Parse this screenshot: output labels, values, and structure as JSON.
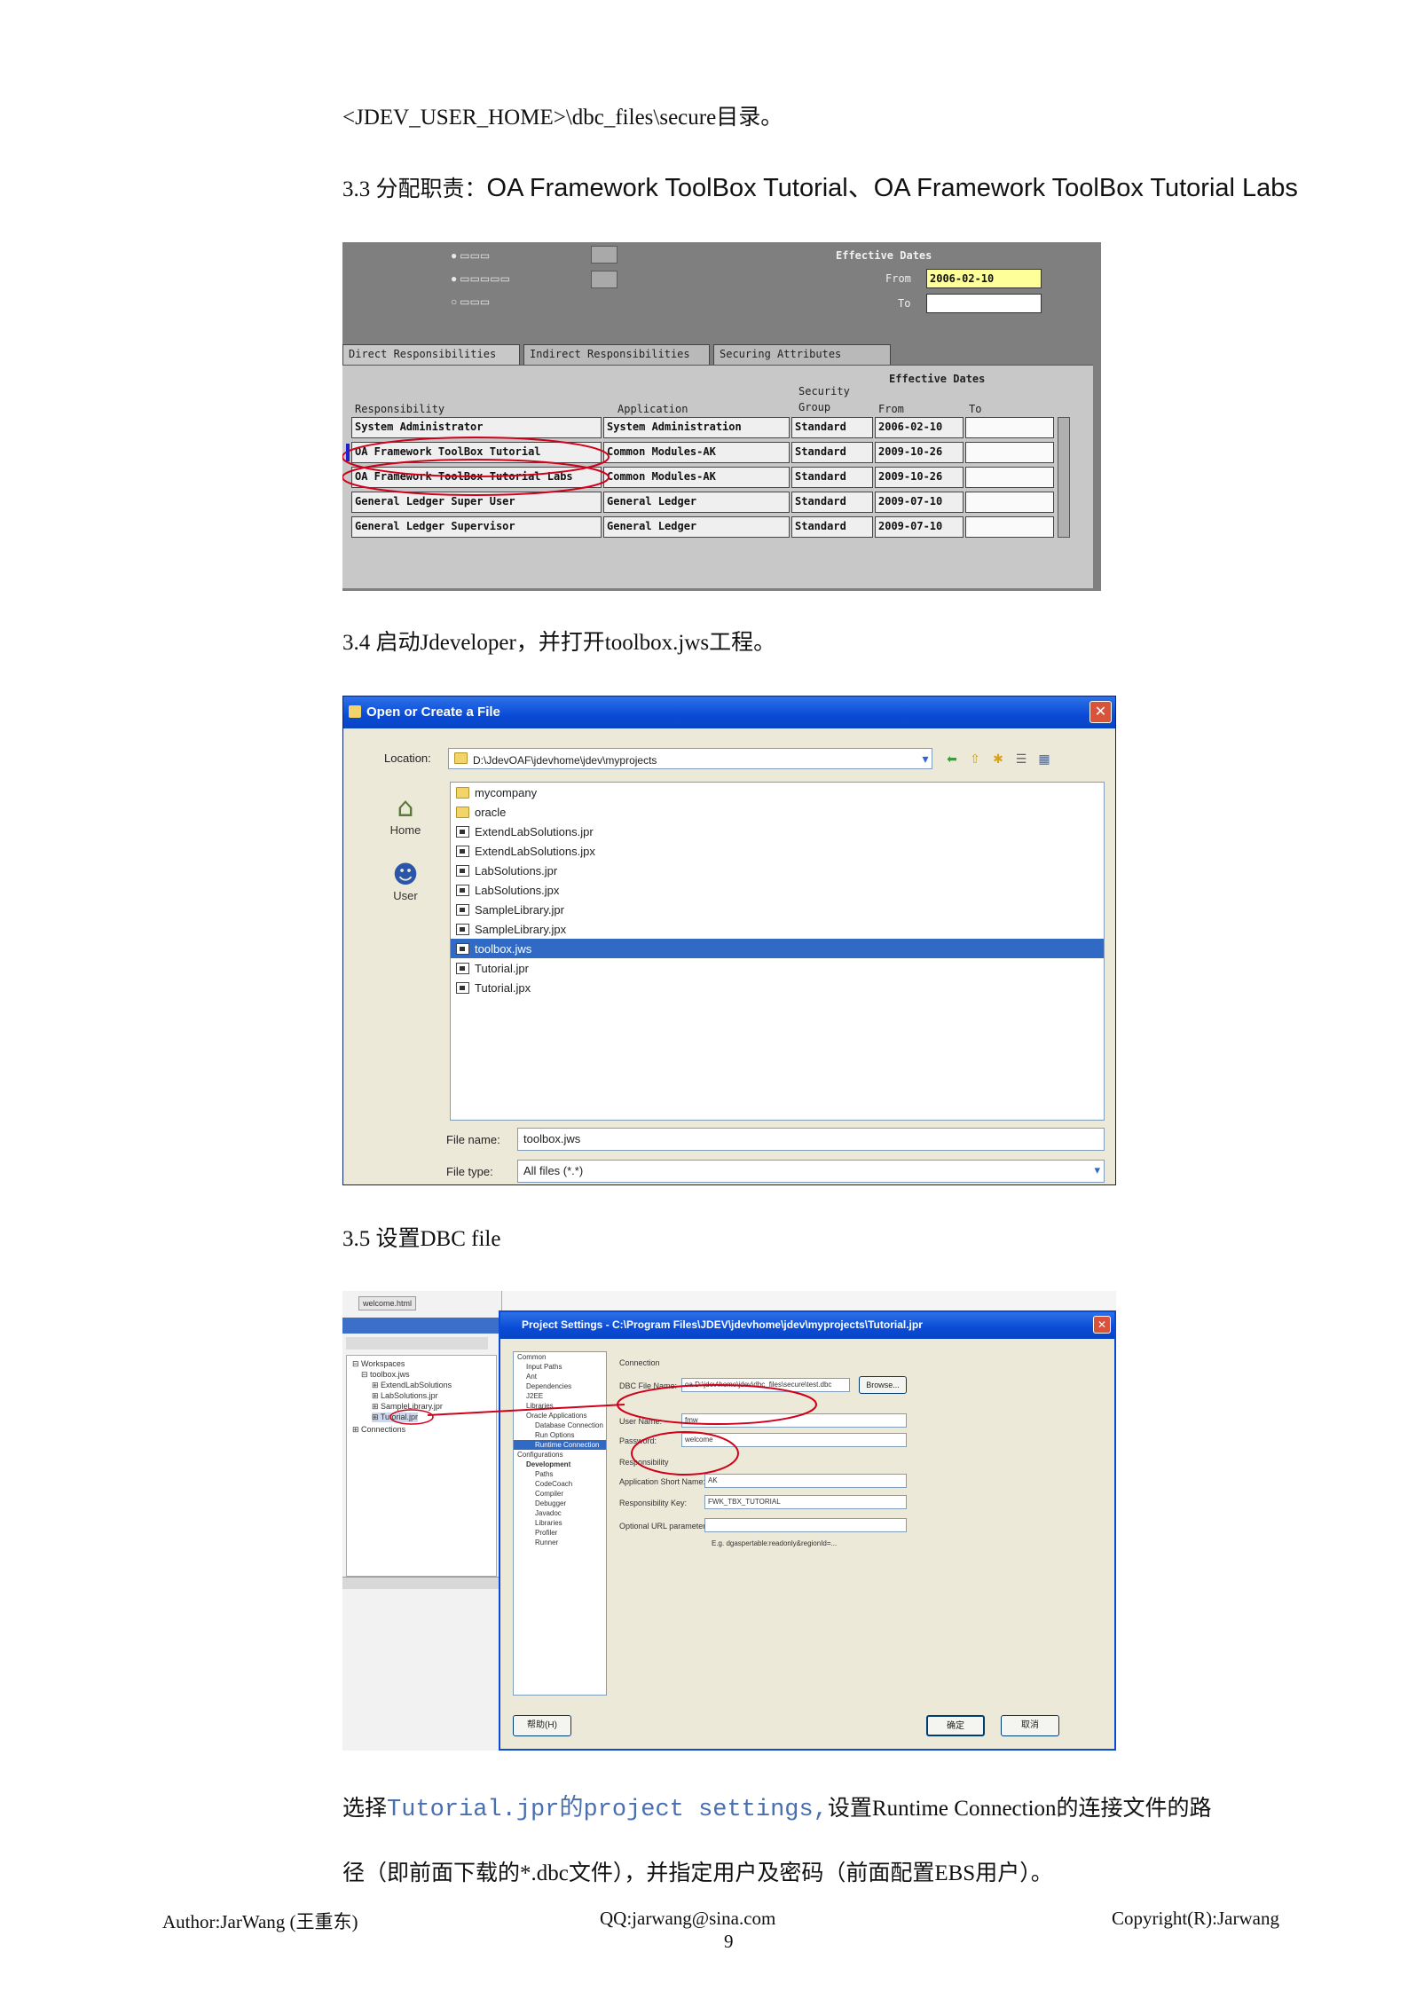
{
  "intro_line": "<JDEV_USER_HOME>\\dbc_files\\secure目录。",
  "section_3_3": {
    "prefix": "3.3 分配职责：",
    "title": "OA Framework ToolBox Tutorial、OA Framework ToolBox Tutorial Labs"
  },
  "forms_screenshot": {
    "effective_dates_label": "Effective Dates",
    "from_label": "From",
    "to_label": "To",
    "from_value": "2006-02-10",
    "tabs": [
      "Direct Responsibilities",
      "Indirect Responsibilities",
      "Securing Attributes"
    ],
    "columns": {
      "responsibility": "Responsibility",
      "application": "Application",
      "security_group": "Security Group",
      "effective_dates": "Effective Dates",
      "from": "From",
      "to": "To"
    },
    "rows": [
      {
        "responsibility": "System Administrator",
        "application": "System Administration",
        "group": "Standard",
        "from": "2006-02-10"
      },
      {
        "responsibility": "OA Framework ToolBox Tutorial",
        "application": "Common Modules-AK",
        "group": "Standard",
        "from": "2009-10-26"
      },
      {
        "responsibility": "OA Framework ToolBox Tutorial Labs",
        "application": "Common Modules-AK",
        "group": "Standard",
        "from": "2009-10-26"
      },
      {
        "responsibility": "General Ledger Super User",
        "application": "General Ledger",
        "group": "Standard",
        "from": "2009-07-10"
      },
      {
        "responsibility": "General Ledger Supervisor",
        "application": "General Ledger",
        "group": "Standard",
        "from": "2009-07-10"
      }
    ]
  },
  "section_3_4": "3.4 启动Jdeveloper，并打开toolbox.jws工程。",
  "open_dialog": {
    "title": "Open or Create a File",
    "location_label": "Location:",
    "location_value": "D:\\JdevOAF\\jdevhome\\jdev\\myprojects",
    "sidebar": [
      "Home",
      "User"
    ],
    "files": [
      {
        "name": "mycompany",
        "kind": "folder",
        "selected": false
      },
      {
        "name": "oracle",
        "kind": "folder",
        "selected": false
      },
      {
        "name": "ExtendLabSolutions.jpr",
        "kind": "doc",
        "selected": false
      },
      {
        "name": "ExtendLabSolutions.jpx",
        "kind": "doc",
        "selected": false
      },
      {
        "name": "LabSolutions.jpr",
        "kind": "doc",
        "selected": false
      },
      {
        "name": "LabSolutions.jpx",
        "kind": "doc",
        "selected": false
      },
      {
        "name": "SampleLibrary.jpr",
        "kind": "doc",
        "selected": false
      },
      {
        "name": "SampleLibrary.jpx",
        "kind": "doc",
        "selected": false
      },
      {
        "name": "toolbox.jws",
        "kind": "doc",
        "selected": true
      },
      {
        "name": "Tutorial.jpr",
        "kind": "doc",
        "selected": false
      },
      {
        "name": "Tutorial.jpx",
        "kind": "doc",
        "selected": false
      }
    ],
    "file_name_label": "File name:",
    "file_name_value": "toolbox.jws",
    "file_type_label": "File type:",
    "file_type_value": "All files (*.*)"
  },
  "section_3_5": "3.5 设置DBC file",
  "settings_dialog": {
    "left_tab": "welcome.html",
    "title": "Project Settings - C:\\Program Files\\JDEV\\jdevhome\\jdev\\myprojects\\Tutorial.jpr",
    "tree": [
      "Common",
      "Input Paths",
      "Ant",
      "Dependencies",
      "J2EE",
      "Libraries",
      "Oracle Applications",
      "Database Connection",
      "Run Options",
      "Runtime Connection",
      "Configurations",
      "Development",
      "Paths",
      "CodeCoach",
      "Compiler",
      "Debugger",
      "Javadoc",
      "Libraries",
      "Profiler",
      "Runner"
    ],
    "connection_label": "Connection",
    "dbc_label": "DBC File Name:",
    "dbc_value": "oa.D:\\jdev\\home\\jdev\\dbc_files\\secure\\test.dbc",
    "browse": "Browse...",
    "user_label": "User Name:",
    "user_value": "fmw",
    "password_label": "Password:",
    "password_value": "welcome",
    "responsibility_label": "Responsibility",
    "app_short_label": "Application Short Name:",
    "app_short_value": "AK",
    "resp_key_label": "Responsibility Key:",
    "resp_key_value": "FWK_TBX_TUTORIAL",
    "url_label": "Optional URL parameters:",
    "url_hint": "E.g. dgaspertable:readonly&regionId=...",
    "help_btn": "帮助(H)",
    "ok_btn": "确定",
    "cancel_btn": "取消"
  },
  "caption": {
    "part1": "选择",
    "part2_code": "Tutorial.jpr的project settings,",
    "part3": "设置Runtime Connection的连接文件的路",
    "line2": "径（即前面下载的*.dbc文件），并指定用户及密码（前面配置EBS用户）。"
  },
  "footer": {
    "author": "Author:JarWang (王重东)",
    "qq": "QQ:jarwang@sina.com",
    "copyright": "Copyright(R):Jarwang",
    "page": "9"
  },
  "colors": {
    "xp_blue": "#0a4bd6",
    "selection": "#316ac5",
    "annotation_red": "#d0021b",
    "code_blue": "#4a6fb0",
    "date_highlight": "#ffff99"
  }
}
